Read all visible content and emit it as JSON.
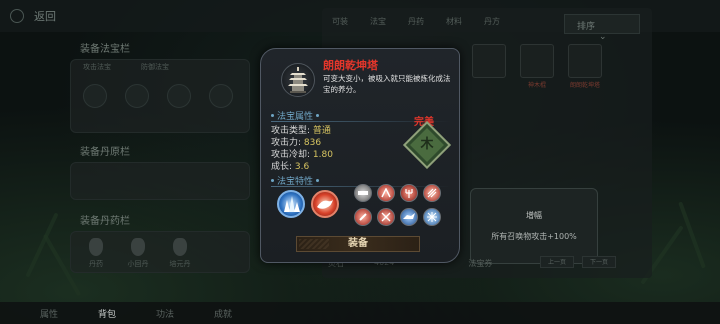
{
  "background": {
    "back_label": "返回",
    "left": {
      "equip_treasure_title": "装备法宝栏",
      "slot_labels": [
        "攻击法宝",
        "防御法宝"
      ],
      "equip_pill_title": "装备丹原栏",
      "equip_elixir_title": "装备丹药栏",
      "elixirs": [
        "丹药",
        "小回丹",
        "培元丹"
      ]
    },
    "right": {
      "tabs": [
        "可装",
        "法宝",
        "丹药",
        "材料",
        "丹方"
      ],
      "sort_label": "排序",
      "items": [
        "",
        "神木棍",
        "朗朗乾坤塔"
      ],
      "buff_title": "增幅",
      "buff_desc": "所有召唤物攻击+100%",
      "bottom": {
        "resource": "灵石",
        "amount": "4024",
        "other": "法宝券"
      },
      "page_prev": "上一页",
      "page_next": "下一页"
    },
    "bottom_tabs": [
      "属性",
      "背包",
      "功法",
      "成就"
    ]
  },
  "popup": {
    "name": "朗朗乾坤塔",
    "name_color": "#e4362b",
    "description": "可变大变小，被吸入就只能被炼化成法宝的养分。",
    "attr_header": "法宝属性",
    "attrs": {
      "type_label": "攻击类型:",
      "type_value": "普通",
      "atk_label": "攻击力:",
      "atk_value": "836",
      "cd_label": "攻击冷却:",
      "cd_value": "1.80",
      "growth_label": "成长:",
      "growth_value": "3.6"
    },
    "quality_label": "完美",
    "quality_glyph": "木",
    "trait_header": "法宝特性",
    "traits_big": [
      "ice-spike-icon",
      "flame-beast-icon"
    ],
    "traits_small": [
      "fist-icon",
      "bloody-claw-icon",
      "trident-icon",
      "blade-fan-icon",
      "dagger-icon",
      "whip-icon",
      "wolf-icon",
      "ice-shards-icon"
    ],
    "equip_label": "装备"
  }
}
